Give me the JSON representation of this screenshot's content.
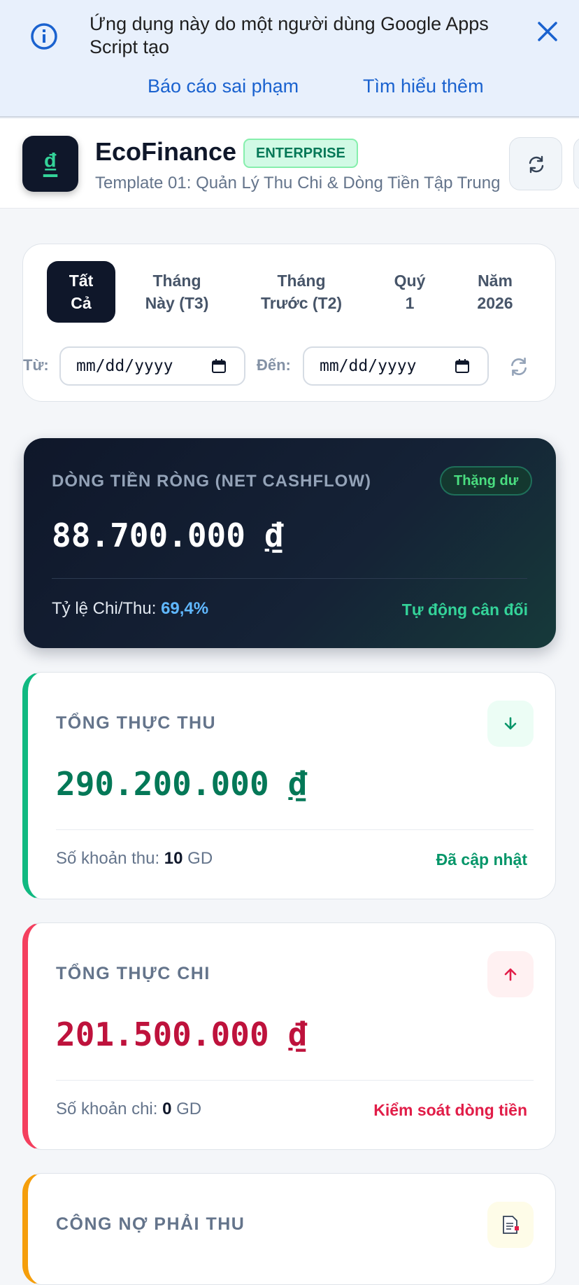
{
  "banner": {
    "message": "Ứng dụng này do một người dùng Google Apps Script tạo",
    "report_link": "Báo cáo sai phạm",
    "learn_link": "Tìm hiểu thêm"
  },
  "header": {
    "logo_symbol": "₫",
    "brand": "EcoFinance",
    "badge": "ENTERPRISE",
    "subtitle": "Template 01: Quản Lý Thu Chi & Dòng Tiền Tập Trung"
  },
  "filter": {
    "tabs": [
      {
        "line1": "Tất",
        "line2": "Cả",
        "active": true
      },
      {
        "line1": "Tháng",
        "line2": "Này (T3)",
        "active": false
      },
      {
        "line1": "Tháng",
        "line2": "Trước (T2)",
        "active": false
      },
      {
        "line1": "Quý",
        "line2": "1",
        "active": false
      },
      {
        "line1": "Năm",
        "line2": "2026",
        "active": false
      }
    ],
    "from_label": "Từ:",
    "to_label": "Đến:",
    "from_placeholder": "mm/dd/yyyy",
    "to_placeholder": "mm/dd/yyyy"
  },
  "net": {
    "label": "DÒNG TIỀN RÒNG (NET CASHFLOW)",
    "badge": "Thặng dư",
    "value": "88.700.000",
    "currency": "₫",
    "ratio_label": "Tỷ lệ Chi/Thu:",
    "ratio_value": "69,4%",
    "auto_label": "Tự động cân đối"
  },
  "income": {
    "label": "TỔNG THỰC THU",
    "value": "290.200.000",
    "currency": "₫",
    "count_label": "Số khoản thu:",
    "count": "10",
    "count_unit": "GD",
    "note": "Đã cập nhật",
    "color": "#047857"
  },
  "expense": {
    "label": "TỔNG THỰC CHI",
    "value": "201.500.000",
    "currency": "₫",
    "count_label": "Số khoản chi:",
    "count": "0",
    "count_unit": "GD",
    "note": "Kiểm soát dòng tiền",
    "color": "#be123c"
  },
  "receivable": {
    "label": "CÔNG NỢ PHẢI THU"
  },
  "colors": {
    "accent_green": "#34d399",
    "income_border": "#10b981",
    "expense_border": "#f43f5e",
    "receivable_border": "#f59e0b",
    "link_blue": "#1a62cf"
  }
}
